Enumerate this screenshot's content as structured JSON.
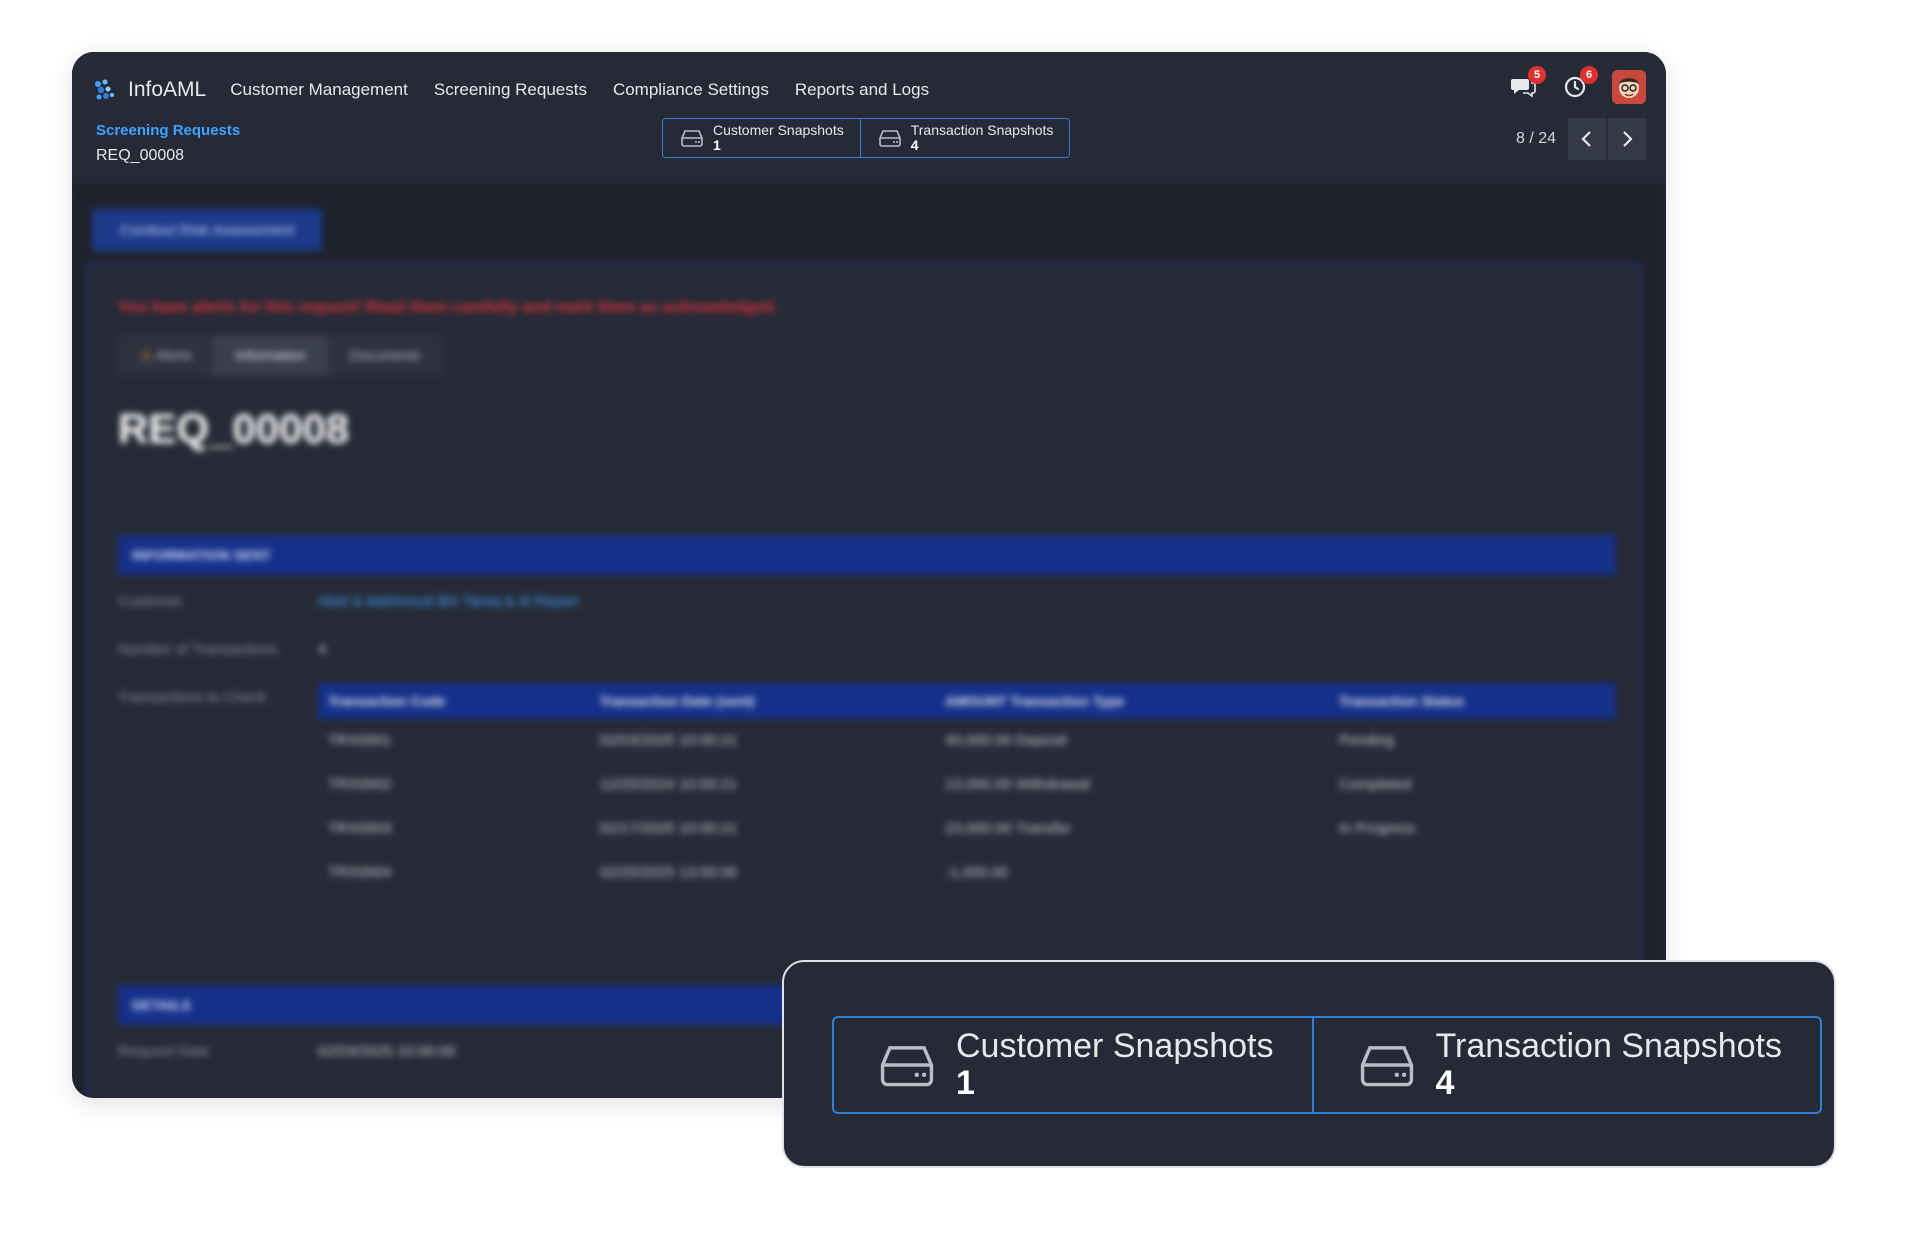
{
  "brand": "InfoAML",
  "menu": [
    {
      "label": "Customer Management"
    },
    {
      "label": "Screening Requests"
    },
    {
      "label": "Compliance Settings"
    },
    {
      "label": "Reports and Logs"
    }
  ],
  "badges": {
    "messages": "5",
    "activities": "6"
  },
  "breadcrumb": {
    "parent": "Screening Requests",
    "current": "REQ_00008"
  },
  "smart_buttons": {
    "customer": {
      "label": "Customer Snapshots",
      "count": "1"
    },
    "transaction": {
      "label": "Transaction Snapshots",
      "count": "4"
    }
  },
  "pager": {
    "text": "8 / 24"
  },
  "colors": {
    "accent": "#2f7fd6",
    "link": "#3ea2ff",
    "badge": "#e03131",
    "section": "#14308a"
  },
  "blurred": {
    "cta": "Conduct Risk Assessment",
    "alert": "You have alerts for this request! Read them carefully and mark them as acknowledged.",
    "tabs": [
      "Alerts",
      "Information",
      "Documents"
    ],
    "title": "REQ_00008",
    "section1": "INFORMATION SENT",
    "customer_label": "Customer",
    "customer_value": "Abel & Mahmoud Bin Tareq & Al Rayan",
    "ntx_label": "Number of Transactions",
    "ntx_value": "4",
    "tx_label": "Transactions to Check",
    "tx_headers": [
      "Transaction Code",
      "Transaction Date (sent)",
      "AMOUNT",
      "Transaction Type",
      "Transaction Status"
    ],
    "tx_rows": [
      [
        "TRX0001",
        "02/03/2025 10:00:21",
        "40,000.00",
        "Deposit",
        "Pending"
      ],
      [
        "TRX0002",
        "12/25/2024 10:00:21",
        "13,000.00",
        "Withdrawal",
        "Completed"
      ],
      [
        "TRX0003",
        "02/17/2025 10:00:21",
        "23,000.00",
        "Transfer",
        "In Progress"
      ],
      [
        "TRX0004",
        "02/25/2025 13:00:00",
        "-1,000.00",
        "",
        ""
      ]
    ],
    "section2": "DETAILS",
    "request_date_label": "Request Date",
    "request_date_value": "02/03/2025 10:00:00"
  }
}
